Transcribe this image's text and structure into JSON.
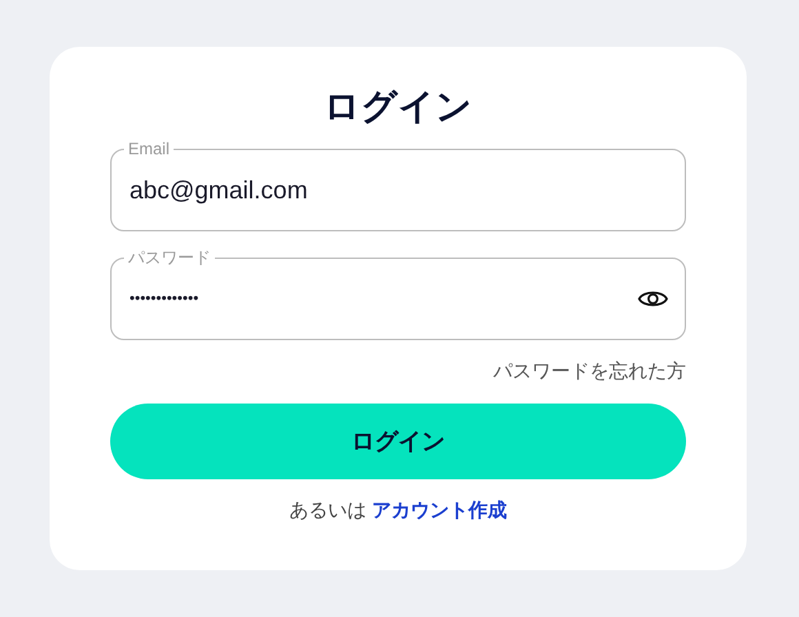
{
  "title": "ログイン",
  "fields": [
    {
      "kind": "text",
      "label": "Email",
      "value": "abc@gmail.com"
    },
    {
      "kind": "password",
      "label": "パスワード",
      "value": "•••••••••••••"
    }
  ],
  "forgot_link": "パスワードを忘れた方",
  "login_button": "ログイン",
  "signup": {
    "prefix": "あるいは",
    "link": "アカウント作成"
  }
}
